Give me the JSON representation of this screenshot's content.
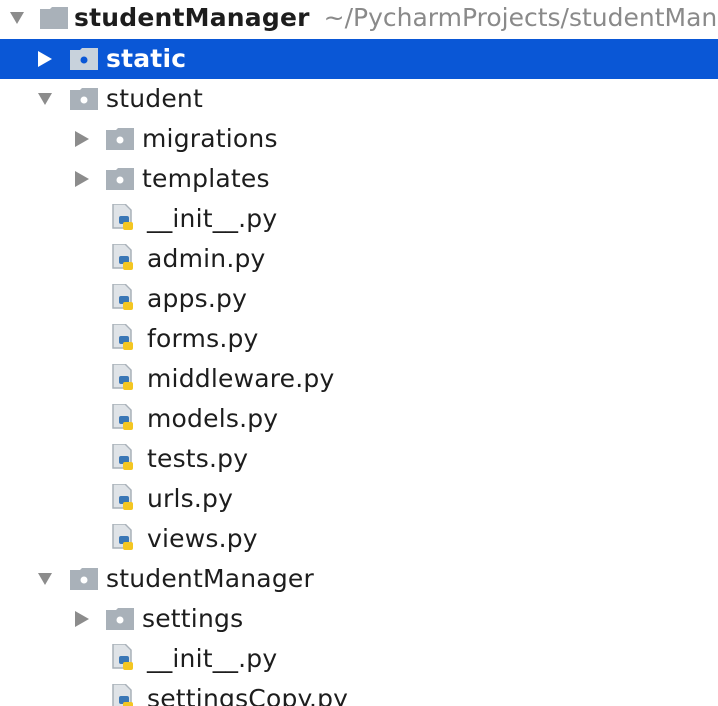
{
  "root": {
    "label": "studentManager",
    "path": "~/PycharmProjects/studentMana"
  },
  "rows": [
    {
      "label": "static",
      "kind": "folder",
      "expanded": false,
      "selected": true
    },
    {
      "label": "student",
      "kind": "folder",
      "expanded": true,
      "selected": false
    },
    {
      "label": "migrations",
      "kind": "folder",
      "expanded": false,
      "selected": false
    },
    {
      "label": "templates",
      "kind": "folder",
      "expanded": false,
      "selected": false
    },
    {
      "label": "__init__.py",
      "kind": "python-file",
      "selected": false
    },
    {
      "label": "admin.py",
      "kind": "python-file",
      "selected": false
    },
    {
      "label": "apps.py",
      "kind": "python-file",
      "selected": false
    },
    {
      "label": "forms.py",
      "kind": "python-file",
      "selected": false
    },
    {
      "label": "middleware.py",
      "kind": "python-file",
      "selected": false
    },
    {
      "label": "models.py",
      "kind": "python-file",
      "selected": false
    },
    {
      "label": "tests.py",
      "kind": "python-file",
      "selected": false
    },
    {
      "label": "urls.py",
      "kind": "python-file",
      "selected": false
    },
    {
      "label": "views.py",
      "kind": "python-file",
      "selected": false
    },
    {
      "label": "studentManager",
      "kind": "folder",
      "expanded": true,
      "selected": false
    },
    {
      "label": "settings",
      "kind": "folder",
      "expanded": false,
      "selected": false
    },
    {
      "label": "__init__.py",
      "kind": "python-file",
      "selected": false
    },
    {
      "label": "settingsCopy.py",
      "kind": "python-file",
      "selected": false
    }
  ],
  "colors": {
    "selection": "#0a57d6",
    "folder": "#a9b1b9",
    "arrow": "#8c8c8c",
    "python_blue": "#3a77b6",
    "python_yellow": "#f3c622"
  }
}
